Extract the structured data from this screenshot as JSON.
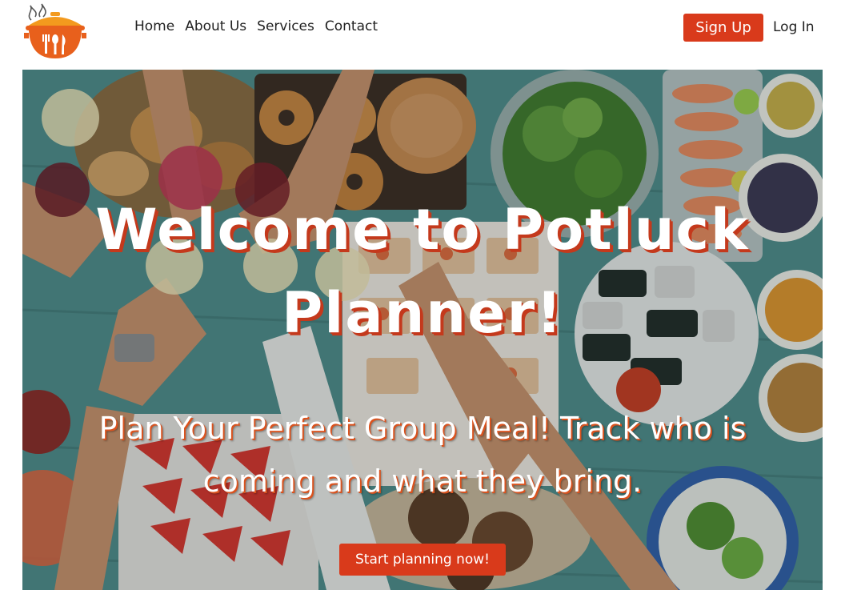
{
  "brand": {
    "logo_icon": "cooking-pot-with-utensils-icon",
    "colors": {
      "accent": "#d93a1b",
      "logo_orange": "#e8601c",
      "logo_lid": "#f39a1e"
    }
  },
  "nav": {
    "items": [
      {
        "label": "Home"
      },
      {
        "label": "About Us"
      },
      {
        "label": "Services"
      },
      {
        "label": "Contact"
      }
    ]
  },
  "auth": {
    "signup_label": "Sign Up",
    "login_label": "Log In"
  },
  "hero": {
    "title": "Welcome to Potluck Planner!",
    "subtitle": "Plan Your Perfect Group Meal! Track who is coming and what they bring.",
    "cta_label": "Start planning now!",
    "background": "overhead photo of a shared table of food with raised glasses"
  }
}
